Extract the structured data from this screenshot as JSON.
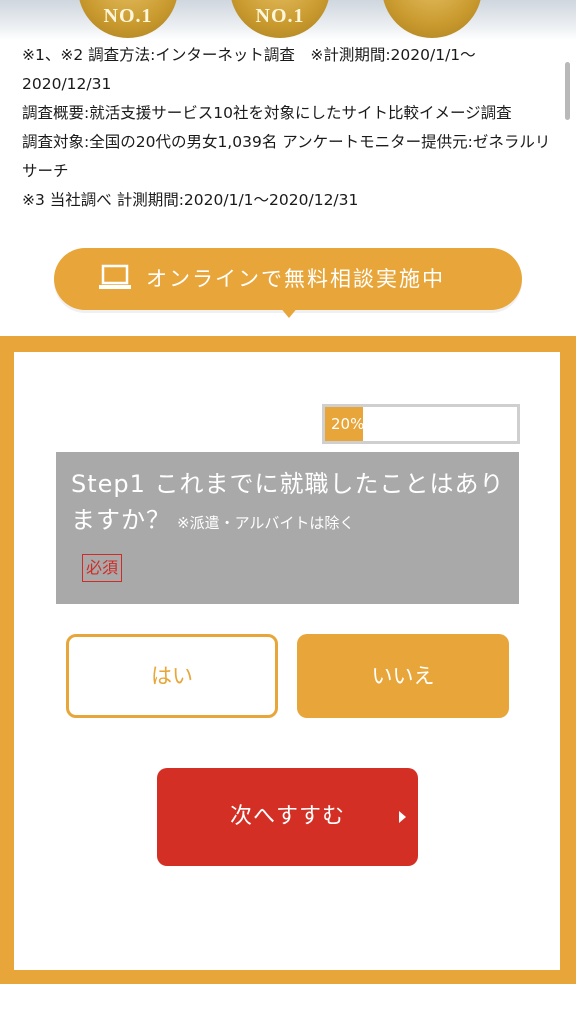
{
  "hero": {
    "medals": [
      "NO.1",
      "NO.1",
      ""
    ]
  },
  "notes": [
    "※1、※2 調査方法:インターネット調査　※計測期間:2020/1/1〜2020/12/31",
    "調査概要:就活支援サービス10社を対象にしたサイト比較イメージ調査",
    "調査対象:全国の20代の男女1,039名 アンケートモニター提供元:ゼネラルリサーチ",
    "※3 当社調べ 計測期間:2020/1/1〜2020/12/31"
  ],
  "banner": {
    "icon": "laptop-icon",
    "text": "オンラインで無料相談実施中"
  },
  "form": {
    "progress_label": "20%",
    "progress_value": 0.2,
    "question": "Step1  これまでに就職したことはありますか？",
    "question_note": "※派遣・アルバイトは除く",
    "required_label": "必須",
    "options": {
      "yes": "はい",
      "no": "いいえ"
    },
    "selected": "no",
    "next_label": "次へすすむ"
  },
  "colors": {
    "accent": "#e8a63a",
    "cta": "#d42f25",
    "question_bg": "#a9a9a9",
    "required": "#d12b27"
  }
}
